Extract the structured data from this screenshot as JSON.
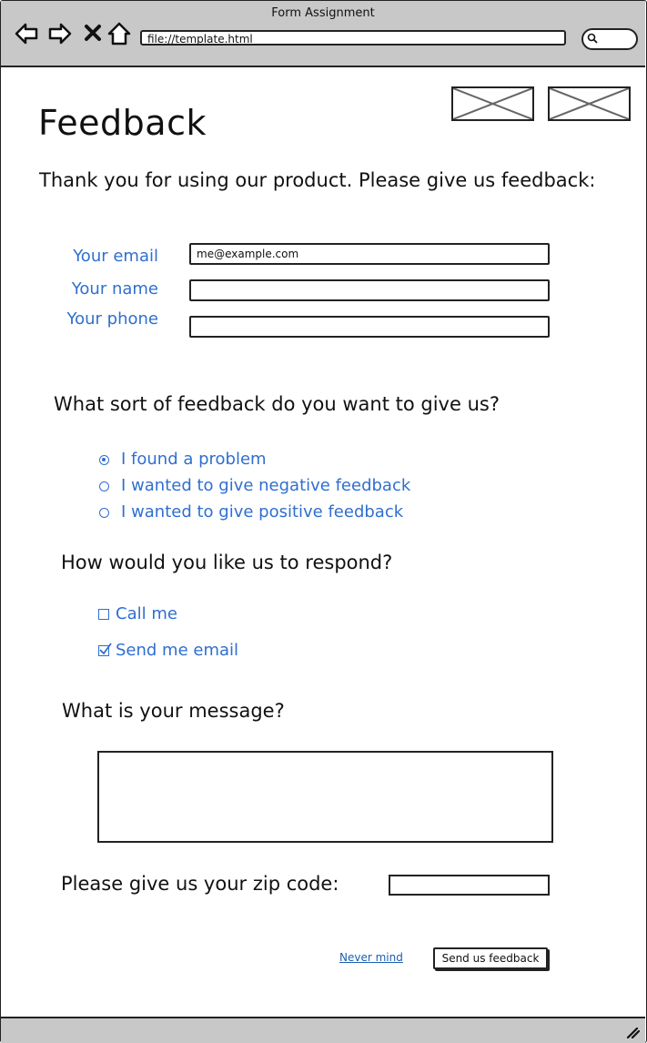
{
  "window": {
    "title": "Form Assignment",
    "address": "file://template.html"
  },
  "page": {
    "heading": "Feedback",
    "intro": "Thank you for using our product. Please give us feedback:"
  },
  "contact": {
    "email_label": "Your email",
    "email_value": "me@example.com",
    "name_label": "Your name",
    "name_value": "",
    "phone_label": "Your phone",
    "phone_value": ""
  },
  "feedback_type": {
    "question": "What sort of feedback do you want to give us?",
    "options": [
      {
        "label": "I found a problem",
        "selected": true
      },
      {
        "label": "I wanted to give negative feedback",
        "selected": false
      },
      {
        "label": "I wanted to give positive feedback",
        "selected": false
      }
    ]
  },
  "respond": {
    "question": "How would you like us to respond?",
    "options": [
      {
        "label": "Call me",
        "checked": false
      },
      {
        "label": "Send me email",
        "checked": true
      }
    ]
  },
  "message": {
    "question": "What is your message?",
    "value": ""
  },
  "zip": {
    "question": "Please give us your zip code:",
    "value": ""
  },
  "actions": {
    "cancel_label": "Never mind",
    "submit_label": "Send us feedback"
  },
  "icons": [
    "back-icon",
    "forward-icon",
    "stop-icon",
    "home-icon",
    "search-icon",
    "resize-grip-icon",
    "image-placeholder-icon"
  ]
}
